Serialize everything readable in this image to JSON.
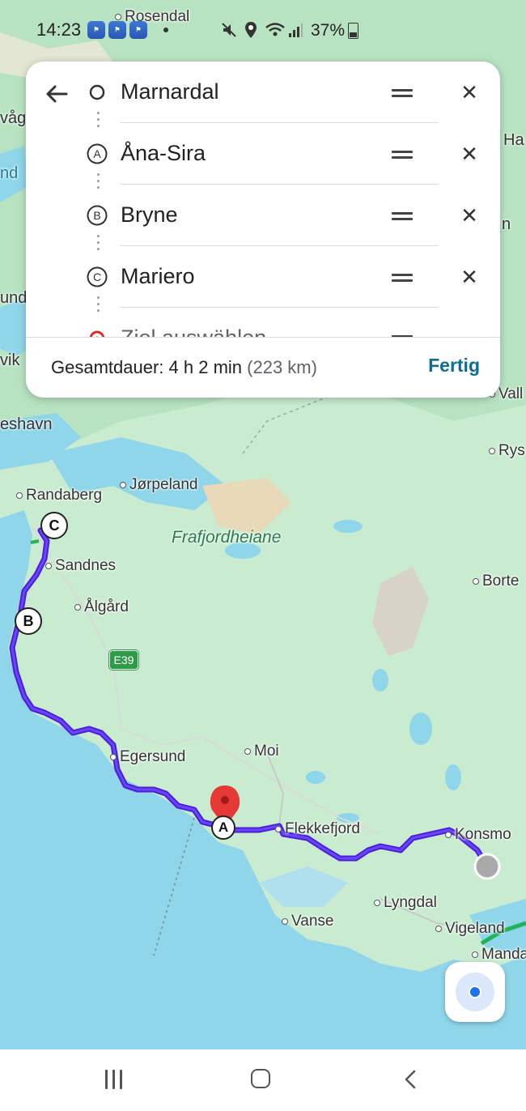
{
  "status_bar": {
    "time": "14:23",
    "battery": "37%",
    "app_badges": [
      "app-badge",
      "app-badge",
      "app-badge"
    ]
  },
  "route_card": {
    "stops": [
      {
        "label": "Marnardal",
        "marker": "origin-circle-icon"
      },
      {
        "label": "Åna-Sira",
        "marker": "A"
      },
      {
        "label": "Bryne",
        "marker": "B"
      },
      {
        "label": "Mariero",
        "marker": "C"
      },
      {
        "label": "Ziel auswählen",
        "marker": "destination-pin-icon"
      }
    ],
    "total_label": "Gesamtdauer:",
    "total_duration": "4 h 2 min",
    "total_distance": "(223 km)",
    "done_label": "Fertig"
  },
  "map": {
    "places": {
      "rosendal": "Rosendal",
      "randaberg": "Randaberg",
      "jorpeland": "Jørpeland",
      "sandnes": "Sandnes",
      "algard": "Ålgård",
      "egersund": "Egersund",
      "moi": "Moi",
      "flekkefjord": "Flekkefjord",
      "konsmo": "Konsmo",
      "lyngdal": "Lyngdal",
      "vanse": "Vanse",
      "vigeland": "Vigeland",
      "borte": "Borte",
      "rys": "Rys",
      "vall": "Vall",
      "mand": "Manda"
    },
    "region": "Frafjordheiane",
    "road_shield": "E39",
    "edge_labels": {
      "vag": "våg",
      "nd": "nd",
      "und": "und",
      "vik": "vik",
      "eshavn": "eshavn",
      "ha": "Ha",
      "n": "n"
    },
    "markers": {
      "a": "A",
      "b": "B",
      "c": "C"
    },
    "colors": {
      "water": "#8fd6ea",
      "land": "#c9ecd0",
      "route": "#4a1fd6",
      "pin": "#e53935"
    }
  }
}
